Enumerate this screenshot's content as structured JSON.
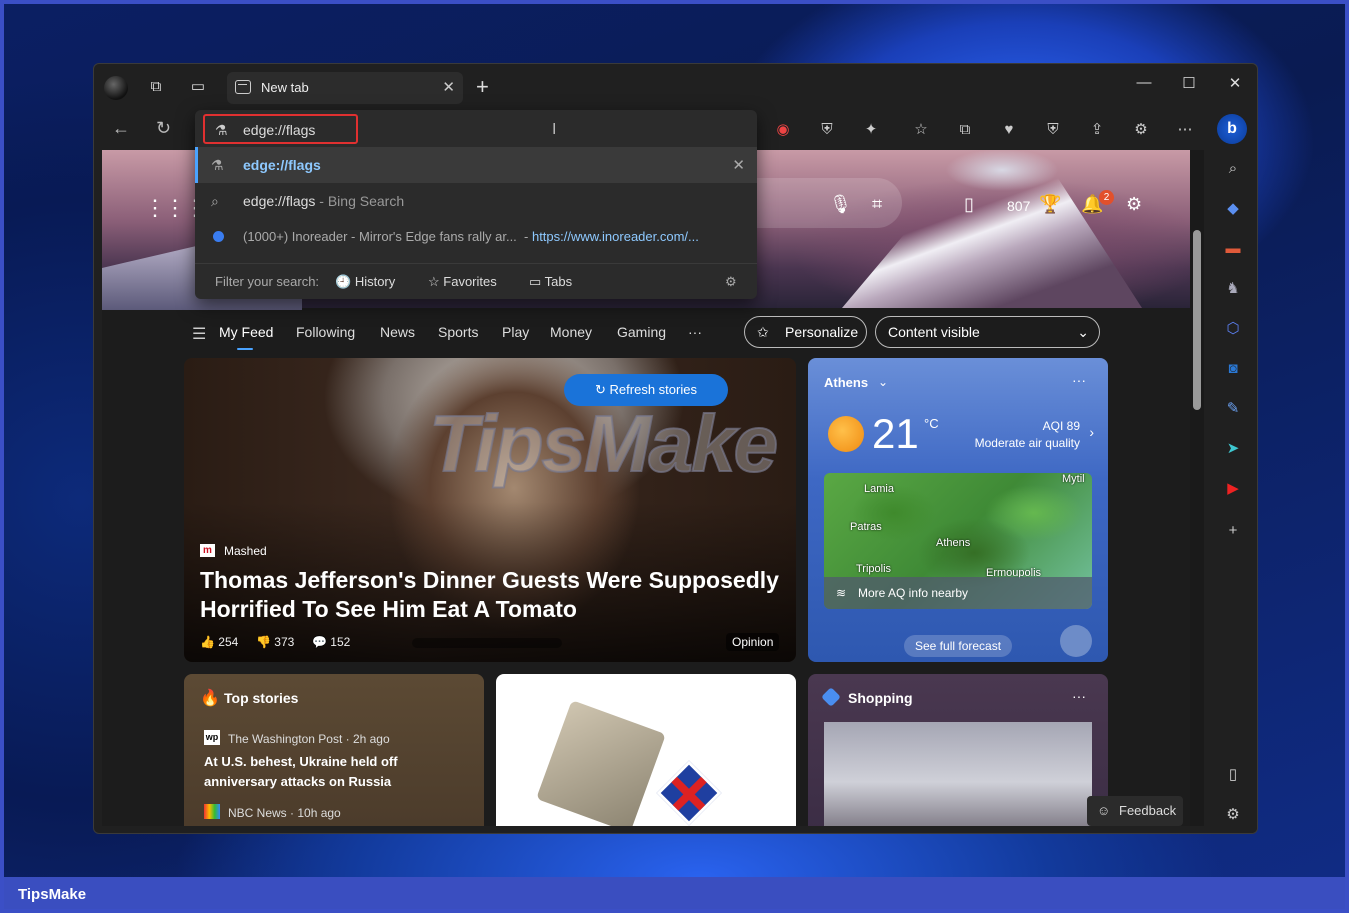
{
  "footer": {
    "brand": "TipsMake"
  },
  "tab": {
    "title": "New tab",
    "close": "✕"
  },
  "window": {
    "newtab": "+",
    "min": "—",
    "max": "☐",
    "close": "✕"
  },
  "addressbar": {
    "value": "edge://flags"
  },
  "suggestions": [
    {
      "icon": "flask-icon",
      "text": "edge://flags",
      "suffix": "",
      "url": ""
    },
    {
      "icon": "search-icon",
      "text": "edge://flags",
      "suffix": " - Bing Search",
      "url": ""
    },
    {
      "icon": "site-icon",
      "text": "(1000+) Inoreader - Mirror's Edge fans rally ar...",
      "suffix": "",
      "url": "https://www.inoreader.com/..."
    }
  ],
  "filter": {
    "label": "Filter your search:",
    "history": "History",
    "favorites": "Favorites",
    "tabs": "Tabs"
  },
  "hero": {
    "points": "807",
    "notifications": "2"
  },
  "feed": {
    "tabs": [
      "My Feed",
      "Following",
      "News",
      "Sports",
      "Play",
      "Money",
      "Gaming",
      "···"
    ],
    "personalize": "Personalize",
    "content_visible": "Content visible"
  },
  "main_story": {
    "refresh": "Refresh stories",
    "watermark": "TipsMake",
    "source": "Mashed",
    "headline": "Thomas Jefferson's Dinner Guests Were Supposedly Horrified To See Him Eat A Tomato",
    "likes": "254",
    "dislikes": "373",
    "comments": "152",
    "tag": "Opinion"
  },
  "weather": {
    "city": "Athens",
    "temp": "21",
    "unit": "°C",
    "aqi": "AQI 89",
    "quality": "Moderate air quality",
    "map_labels": [
      "Lamia",
      "Patras",
      "Athens",
      "Tripolis",
      "Ermoupolis",
      "Mytil"
    ],
    "aq_more": "More AQ info nearby",
    "forecast": "See full forecast"
  },
  "top_stories": {
    "title": "Top stories",
    "source1": "The Washington Post · 2h ago",
    "headline1": "At U.S. behest, Ukraine held off anniversary attacks on Russia",
    "source2": "NBC News · 10h ago"
  },
  "shopping": {
    "title": "Shopping"
  },
  "feedback": "Feedback",
  "colors": {
    "accent": "#4aa3ff",
    "refresh": "#1a73d9",
    "highlight_border": "#e03030"
  }
}
